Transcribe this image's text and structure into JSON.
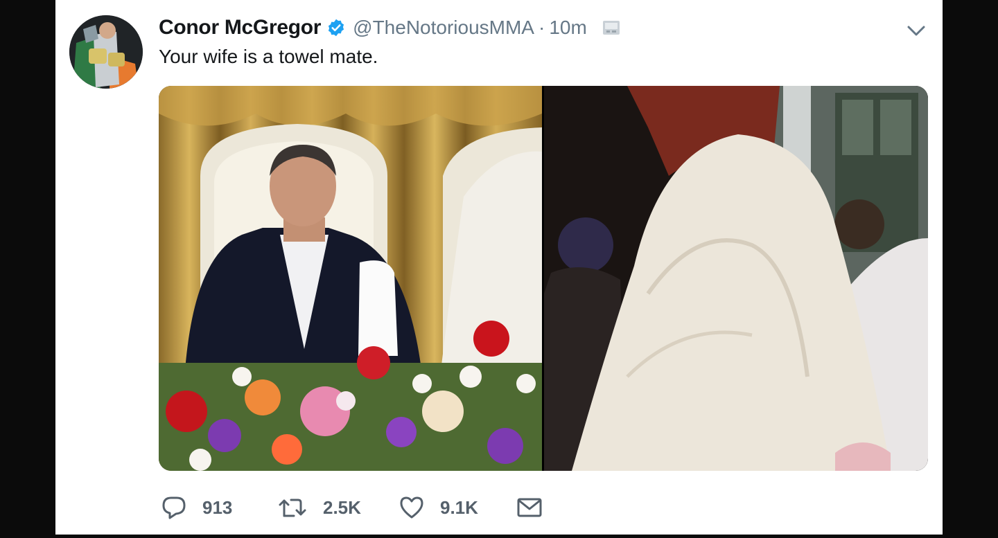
{
  "tweet": {
    "display_name": "Conor McGregor",
    "handle": "@TheNotoriousMMA",
    "separator": "·",
    "time": "10m",
    "text": "Your wife is a towel mate.",
    "verified": true
  },
  "actions": {
    "reply_count": "913",
    "retweet_count": "2.5K",
    "like_count": "9.1K"
  },
  "icons": {
    "verified": "verified-badge-icon",
    "app": "app-source-icon",
    "caret": "chevron-down-icon",
    "reply": "reply-bubble-icon",
    "retweet": "retweet-icon",
    "like": "heart-icon",
    "dm": "envelope-icon"
  },
  "colors": {
    "verified_blue": "#1da1f2",
    "text_primary": "#14171a",
    "text_secondary": "#657786",
    "frame_black": "#0b0b0b"
  }
}
